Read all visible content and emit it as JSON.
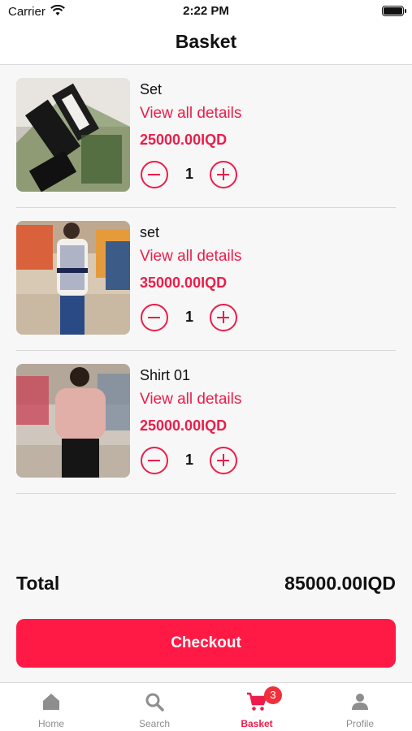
{
  "status_bar": {
    "carrier": "Carrier",
    "time": "2:22 PM"
  },
  "header": {
    "title": "Basket"
  },
  "basket": {
    "details_label": "View all details",
    "items": [
      {
        "name": "Set",
        "price": "25000.00IQD",
        "quantity": "1"
      },
      {
        "name": "set",
        "price": "35000.00IQD",
        "quantity": "1"
      },
      {
        "name": "Shirt 01",
        "price": "25000.00IQD",
        "quantity": "1"
      }
    ]
  },
  "summary": {
    "total_label": "Total",
    "total_value": "85000.00IQD"
  },
  "checkout": {
    "label": "Checkout"
  },
  "tab_bar": {
    "tabs": [
      {
        "label": "Home",
        "icon": "home-icon"
      },
      {
        "label": "Search",
        "icon": "search-icon"
      },
      {
        "label": "Basket",
        "icon": "cart-icon",
        "badge": "3",
        "active": true
      },
      {
        "label": "Profile",
        "icon": "person-icon"
      }
    ]
  },
  "colors": {
    "accent": "#ec1d4a",
    "checkout": "#ff1a45",
    "badge": "#f0303c",
    "inactive": "#8e8e8e"
  }
}
